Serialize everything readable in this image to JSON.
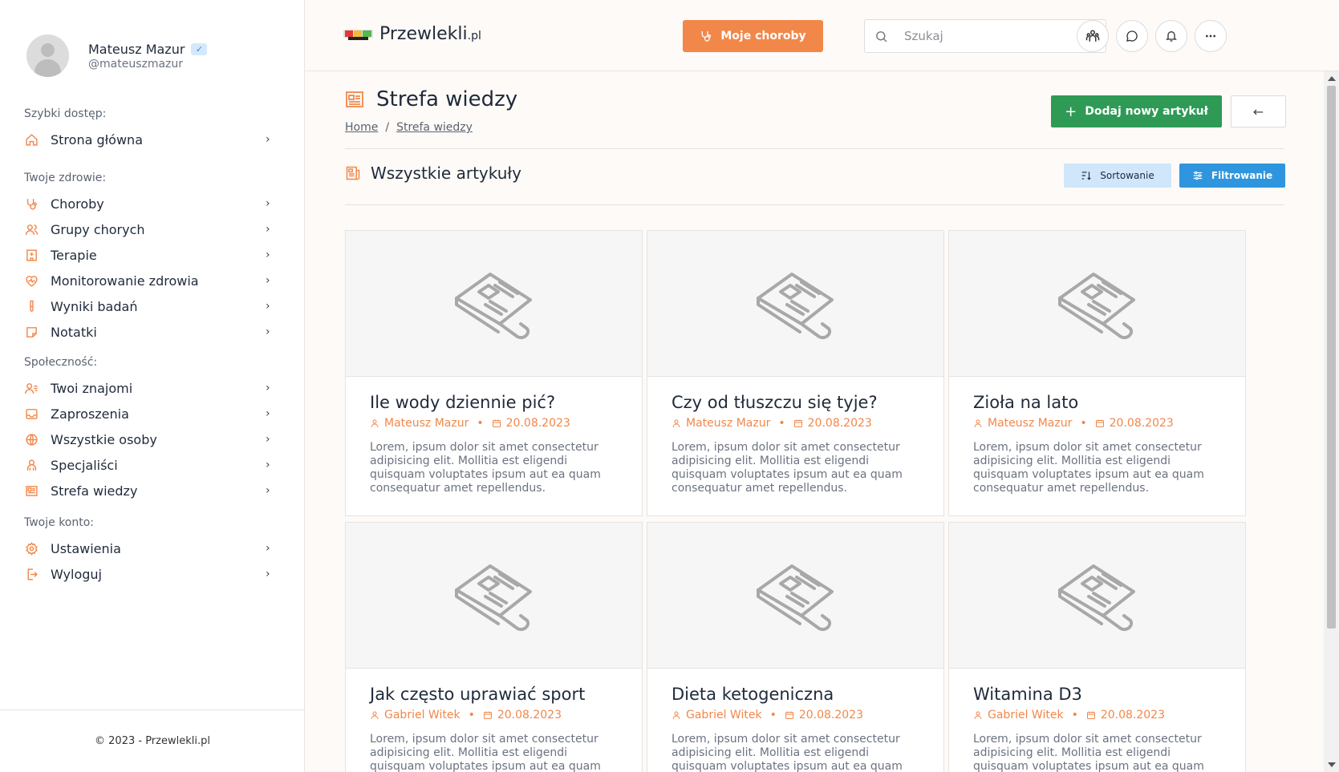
{
  "profile": {
    "name": "Mateusz Mazur",
    "handle": "@mateuszmazur",
    "verified_mark": "✓"
  },
  "sidebar": {
    "sections": [
      {
        "title": "Szybki dostęp:",
        "items": [
          {
            "label": "Strona główna",
            "icon": "home-icon"
          }
        ]
      },
      {
        "title": "Twoje zdrowie:",
        "items": [
          {
            "label": "Choroby",
            "icon": "stethoscope-icon"
          },
          {
            "label": "Grupy chorych",
            "icon": "users-icon"
          },
          {
            "label": "Terapie",
            "icon": "hospital-icon"
          },
          {
            "label": "Monitorowanie zdrowia",
            "icon": "heart-pulse-icon"
          },
          {
            "label": "Wyniki badań",
            "icon": "test-tube-icon"
          },
          {
            "label": "Notatki",
            "icon": "note-icon"
          }
        ]
      },
      {
        "title": "Społeczność:",
        "items": [
          {
            "label": "Twoi znajomi",
            "icon": "user-list-icon"
          },
          {
            "label": "Zaproszenia",
            "icon": "inbox-icon"
          },
          {
            "label": "Wszystkie osoby",
            "icon": "globe-icon"
          },
          {
            "label": "Specjaliści",
            "icon": "specialist-icon"
          },
          {
            "label": "Strefa wiedzy",
            "icon": "newspaper-icon"
          }
        ]
      },
      {
        "title": "Twoje konto:",
        "items": [
          {
            "label": "Ustawienia",
            "icon": "gear-icon"
          },
          {
            "label": "Wyloguj",
            "icon": "logout-icon"
          }
        ]
      }
    ],
    "footer": "© 2023 - Przewlekli.pl"
  },
  "topbar": {
    "logo_main": "Przewlekli",
    "logo_suffix": ".pl",
    "diseases_button": "Moje choroby",
    "search_placeholder": "Szukaj"
  },
  "page": {
    "title": "Strefa wiedzy",
    "breadcrumb": [
      "Home",
      "Strefa wiedzy"
    ],
    "breadcrumb_sep": "/",
    "add_button": "Dodaj nowy artykuł",
    "add_button_icon": "+",
    "back_icon": "←"
  },
  "section": {
    "title": "Wszystkie artykuły",
    "sort_button": "Sortowanie",
    "filter_button": "Filtrowanie"
  },
  "articles": [
    {
      "title": "Ile wody dziennie pić?",
      "author": "Mateusz Mazur",
      "date": "20.08.2023",
      "excerpt": "Lorem, ipsum dolor sit amet consectetur adipisicing elit. Mollitia est eligendi quisquam voluptates ipsum aut ea quam consequatur amet repellendus."
    },
    {
      "title": "Czy od tłuszczu się tyje?",
      "author": "Mateusz Mazur",
      "date": "20.08.2023",
      "excerpt": "Lorem, ipsum dolor sit amet consectetur adipisicing elit. Mollitia est eligendi quisquam voluptates ipsum aut ea quam consequatur amet repellendus."
    },
    {
      "title": "Zioła na lato",
      "author": "Mateusz Mazur",
      "date": "20.08.2023",
      "excerpt": "Lorem, ipsum dolor sit amet consectetur adipisicing elit. Mollitia est eligendi quisquam voluptates ipsum aut ea quam consequatur amet repellendus."
    },
    {
      "title": "Jak często uprawiać sport",
      "author": "Gabriel Witek",
      "date": "20.08.2023",
      "excerpt": "Lorem, ipsum dolor sit amet consectetur adipisicing elit. Mollitia est eligendi quisquam voluptates ipsum aut ea quam consequatur amet repellendus."
    },
    {
      "title": "Dieta ketogeniczna",
      "author": "Gabriel Witek",
      "date": "20.08.2023",
      "excerpt": "Lorem, ipsum dolor sit amet consectetur adipisicing elit. Mollitia est eligendi quisquam voluptates ipsum aut ea quam consequatur amet repellendus."
    },
    {
      "title": "Witamina D3",
      "author": "Gabriel Witek",
      "date": "20.08.2023",
      "excerpt": "Lorem, ipsum dolor sit amet consectetur adipisicing elit. Mollitia est eligendi quisquam voluptates ipsum aut ea quam consequatur amet repellendus."
    }
  ],
  "meta_separator": "•",
  "colors": {
    "accent_orange": "#f2874a",
    "accent_green": "#2e9a55",
    "accent_blue": "#2e95de",
    "sort_bg": "#cfe6fb"
  }
}
